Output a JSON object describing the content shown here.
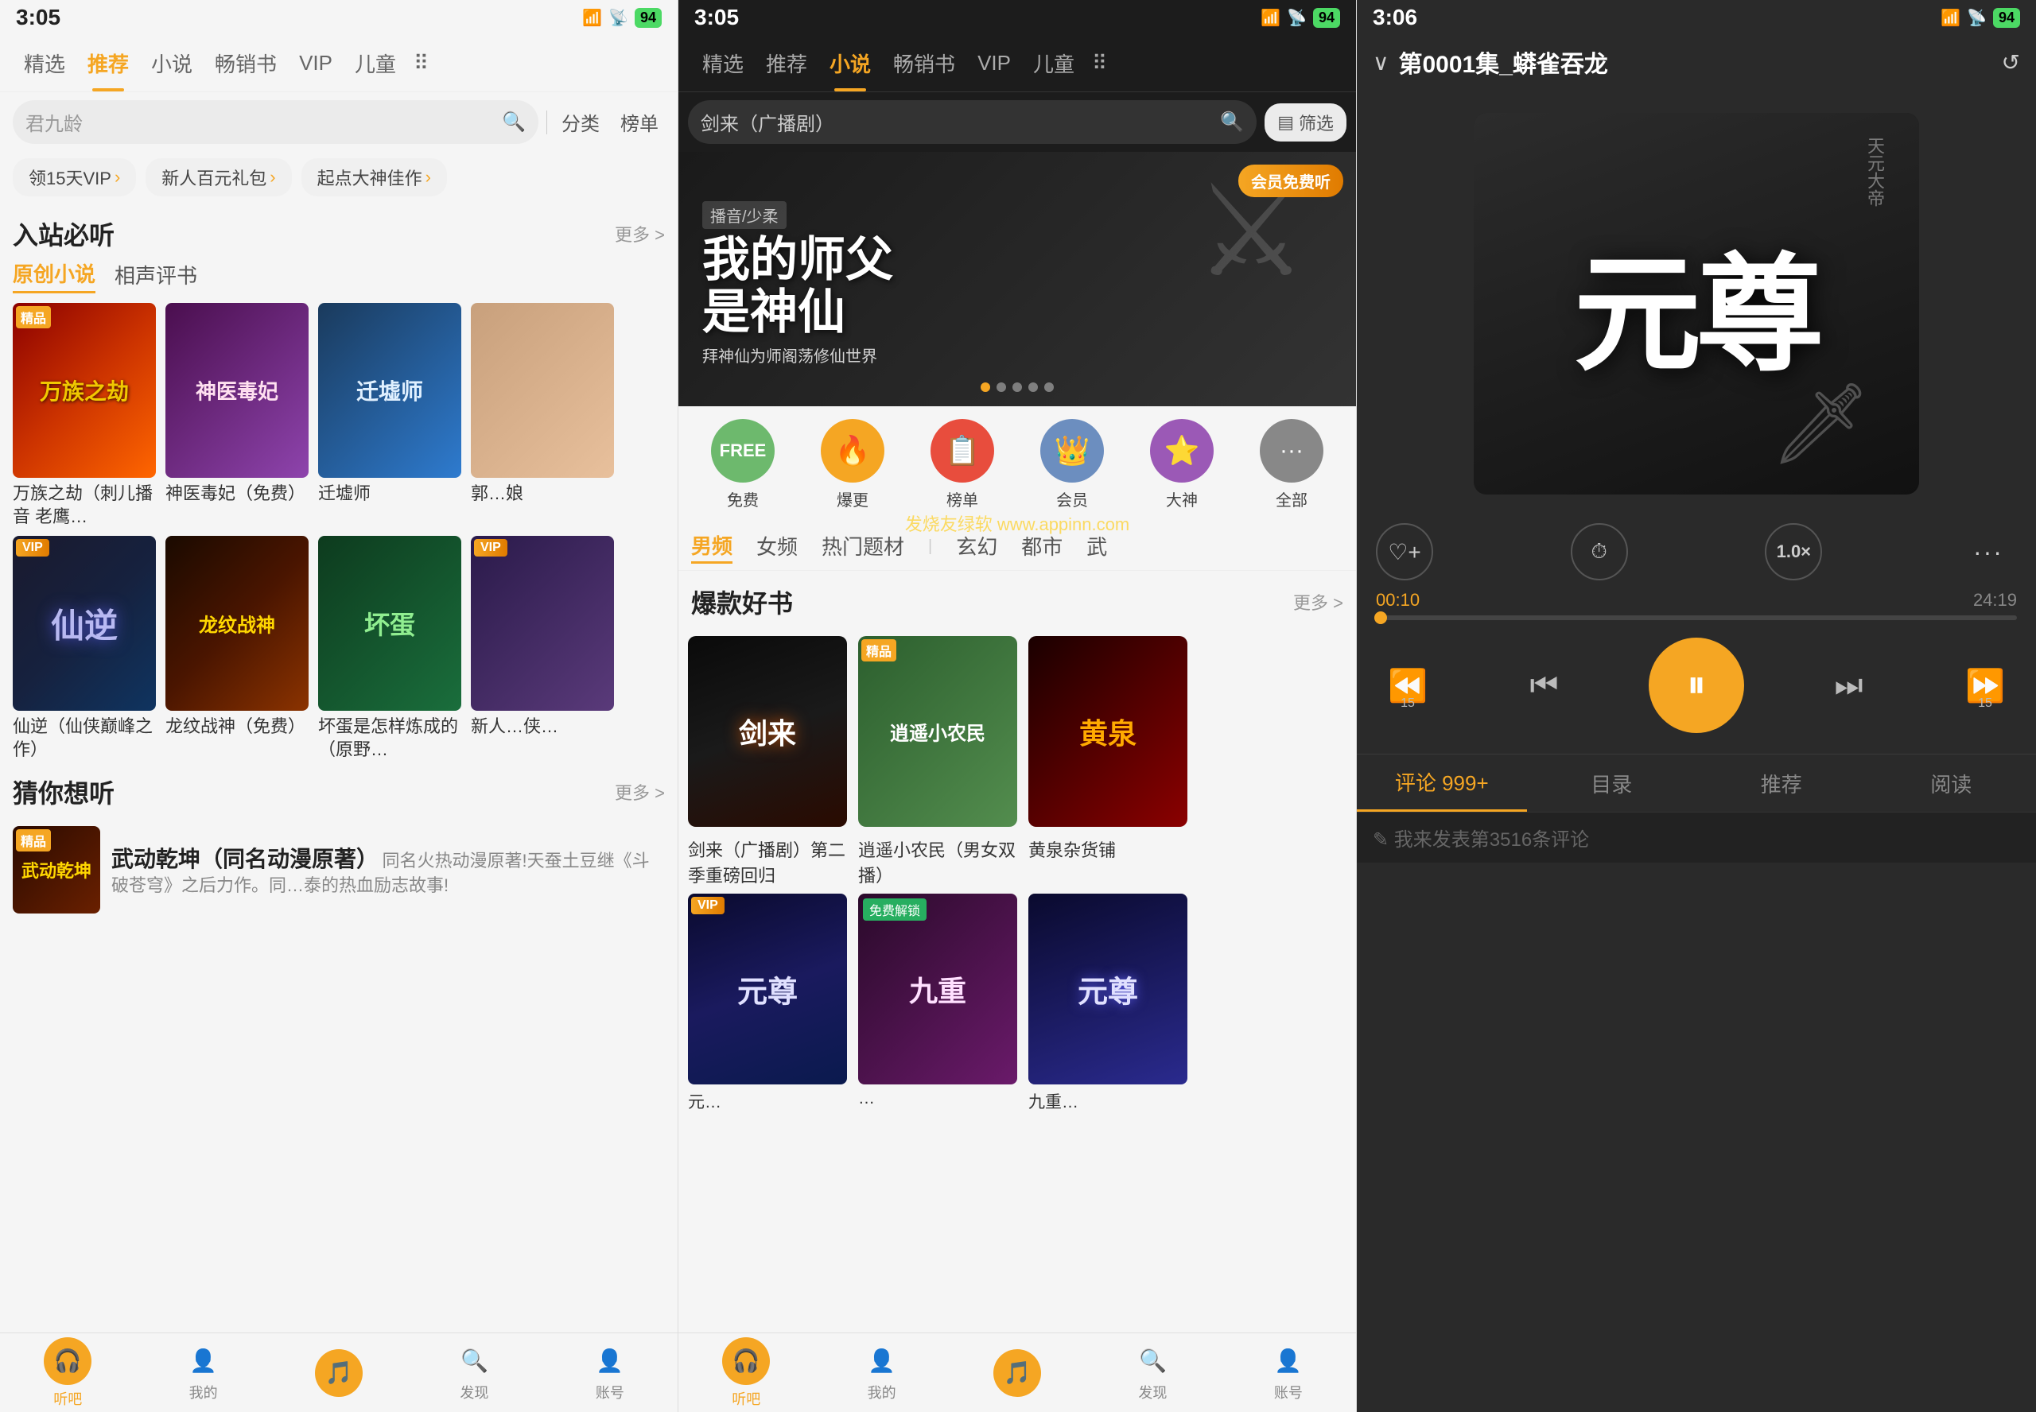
{
  "panel_left": {
    "status": {
      "time": "3:05",
      "icons": [
        "signal",
        "wifi",
        "battery"
      ],
      "battery_level": "94"
    },
    "nav": {
      "tabs": [
        {
          "label": "精选",
          "active": false
        },
        {
          "label": "推荐",
          "active": true
        },
        {
          "label": "小说",
          "active": false
        },
        {
          "label": "畅销书",
          "active": false
        },
        {
          "label": "VIP",
          "active": false
        },
        {
          "label": "儿童",
          "active": false
        }
      ],
      "more_icon": "⠿"
    },
    "search": {
      "placeholder": "君九龄",
      "classify_label": "分类",
      "rank_label": "榜单"
    },
    "promo": [
      {
        "label": "领15天VIP",
        "arrow": "›"
      },
      {
        "label": "新人百元礼包",
        "arrow": "›"
      },
      {
        "label": "起点大神佳作",
        "arrow": "›"
      }
    ],
    "must_listen": {
      "title": "入站必听",
      "more": "更多 >",
      "sub_tabs": [
        {
          "label": "原创小说",
          "active": true
        },
        {
          "label": "相声评书",
          "active": false
        }
      ]
    },
    "original_books": [
      {
        "id": "wanzuzhidong",
        "badge": "精品",
        "title": "万族之劫（刺儿播音 老鹰…"
      },
      {
        "id": "shenyidubi",
        "badge": "",
        "title": "神医毒妃（免费）"
      },
      {
        "id": "qianxueshi",
        "badge": "",
        "title": "迁墟师"
      },
      {
        "id": "guoniang",
        "badge": "",
        "title": "郭…娘"
      }
    ],
    "vip_books": [
      {
        "id": "xiannidi",
        "badge": "VIP",
        "title": "仙逆（仙侠巅峰之作）"
      },
      {
        "id": "longwen",
        "badge": "",
        "title": "龙纹战神（免费）"
      },
      {
        "id": "huaidan",
        "badge": "",
        "title": "坏蛋是怎样炼成的（原野…"
      },
      {
        "id": "xinren",
        "badge": "VIP",
        "title": "新人…侠…"
      }
    ],
    "guess_section": {
      "title": "猜你想听",
      "more": "更多 >",
      "item": {
        "id": "wudong",
        "badge": "精品",
        "title": "武动乾坤（同名动漫原著）",
        "desc": "同名火热动漫原著!天蚕土豆继《斗破苍穹》之后力作。同…泰的热血励志故事!"
      }
    },
    "bottom_nav": [
      {
        "icon": "🎧",
        "label": "听吧",
        "active": true
      },
      {
        "icon": "👤",
        "label": "我的",
        "active": false
      },
      {
        "icon": "🎵",
        "label": "",
        "active": false,
        "center": true
      },
      {
        "icon": "🔍",
        "label": "发现",
        "active": false
      },
      {
        "icon": "👤",
        "label": "账号",
        "active": false
      }
    ]
  },
  "panel_mid": {
    "status": {
      "time": "3:05",
      "battery_level": "94"
    },
    "nav": {
      "tabs": [
        {
          "label": "精选",
          "active": false
        },
        {
          "label": "推荐",
          "active": false
        },
        {
          "label": "小说",
          "active": true
        },
        {
          "label": "畅销书",
          "active": false
        },
        {
          "label": "VIP",
          "active": false
        },
        {
          "label": "儿童",
          "active": false
        }
      ]
    },
    "search": {
      "value": "剑来（广播剧）",
      "filter_label": "筛选"
    },
    "banner": {
      "big_title": "我的师父\n是神仙",
      "category": "播音/少柔",
      "subtitle": "拜神仙为师阁荡修仙世界",
      "vip_badge": "会员免费听",
      "dots": [
        true,
        false,
        false,
        false,
        false
      ]
    },
    "categories": [
      {
        "icon": "FREE",
        "label": "免费",
        "color": "cat-free"
      },
      {
        "icon": "🔥",
        "label": "爆更",
        "color": "cat-hot"
      },
      {
        "icon": "📋",
        "label": "榜单",
        "color": "cat-rank"
      },
      {
        "icon": "👑",
        "label": "会员",
        "color": "cat-vip"
      },
      {
        "icon": "⭐",
        "label": "大神",
        "color": "cat-god"
      },
      {
        "icon": "⋯",
        "label": "全部",
        "color": "cat-all"
      }
    ],
    "filter_tabs": [
      {
        "label": "男频",
        "active": true
      },
      {
        "label": "女频",
        "active": false
      },
      {
        "label": "热门题材",
        "active": false
      },
      {
        "label": "玄幻",
        "active": false
      },
      {
        "label": "都市",
        "active": false
      },
      {
        "label": "武",
        "active": false
      }
    ],
    "hot_books": {
      "title": "爆款好书",
      "more": "更多 >",
      "items": [
        {
          "id": "jianlai",
          "badge": "",
          "title": "剑来（广播剧）第二季重磅回归"
        },
        {
          "id": "xiaonongmin",
          "badge": "精品",
          "title": "逍遥小农民（男女双播）"
        },
        {
          "id": "huangquan",
          "badge": "",
          "title": "黄泉杂货铺"
        }
      ]
    },
    "vip_row": [
      {
        "id": "midyuanzun",
        "badge": "VIP",
        "title": "元…"
      },
      {
        "id": "jiuchong",
        "badge": "免费解锁",
        "title": "…"
      },
      {
        "id": "yuanzun2",
        "badge": "",
        "title": "九重…"
      }
    ],
    "watermark": "发烧友绿软 www.appinn.com",
    "bottom_nav": [
      {
        "icon": "🎧",
        "label": "听吧",
        "active": true
      },
      {
        "icon": "👤",
        "label": "我的",
        "active": false
      },
      {
        "icon": "🎵",
        "label": "",
        "active": false,
        "center": true
      },
      {
        "icon": "🔍",
        "label": "发现",
        "active": false
      },
      {
        "icon": "👤",
        "label": "账号",
        "active": false
      }
    ]
  },
  "panel_right": {
    "status": {
      "time": "3:06",
      "battery_level": "94"
    },
    "header": {
      "back_icon": "∨",
      "title": "第0001集_蟒雀吞龙",
      "refresh_icon": "↺"
    },
    "album": {
      "title": "元尊",
      "subtitle": "天元大帝"
    },
    "controls": {
      "favorite_label": "♡+",
      "timer_label": "⏱",
      "speed_label": "1.0×",
      "more_label": "···"
    },
    "progress": {
      "current": "00:10",
      "total": "24:19",
      "percent": 0.7
    },
    "playback": {
      "rewind_label": "15",
      "prev_label": "⏮",
      "play_label": "⏸",
      "next_label": "⏭",
      "forward_label": "15"
    },
    "tabs": [
      {
        "label": "评论 999+",
        "active": true
      },
      {
        "label": "目录",
        "active": false
      },
      {
        "label": "推荐",
        "active": false
      },
      {
        "label": "阅读",
        "active": false
      }
    ],
    "comment_placeholder": "✎ 我来发表第3516条评论"
  }
}
